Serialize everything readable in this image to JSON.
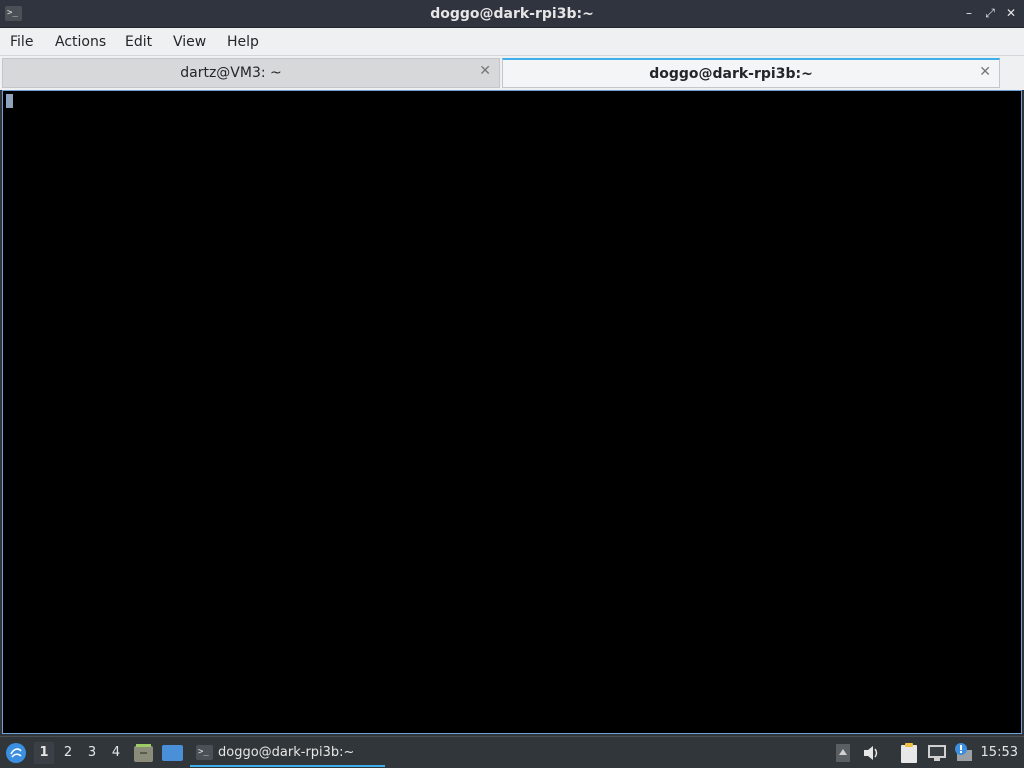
{
  "window": {
    "title": "doggo@dark-rpi3b:~",
    "app_icon": ">_",
    "controls": {
      "minimize": "–",
      "restore": "⤢",
      "close": "✕"
    }
  },
  "menu": [
    "File",
    "Actions",
    "Edit",
    "View",
    "Help"
  ],
  "tabs": [
    {
      "label": "dartz@VM3: ~",
      "active": false,
      "close": "✕"
    },
    {
      "label": "doggo@dark-rpi3b:~",
      "active": true,
      "close": "✕"
    }
  ],
  "taskbar": {
    "workspaces": [
      "1",
      "2",
      "3",
      "4"
    ],
    "active_workspace": "1",
    "task_label": "doggo@dark-rpi3b:~",
    "task_icon": ">_",
    "clock": "15:53",
    "icons": [
      "app-launcher-icon",
      "file-manager-icon",
      "show-desktop-icon",
      "terminal-icon",
      "tray-arrow-icon",
      "volume-icon",
      "clipboard-icon",
      "network-icon",
      "notification-icon"
    ]
  },
  "colors": {
    "accent": "#3daee9",
    "terminal_bg": "#000000",
    "panel_bg": "#31363b",
    "title_bg": "#2f343f"
  }
}
